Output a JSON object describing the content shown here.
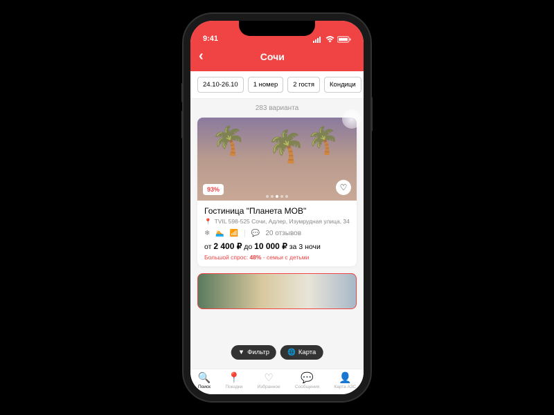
{
  "status": {
    "time": "9:41"
  },
  "header": {
    "title": "Сочи"
  },
  "pills": [
    "24.10-26.10",
    "1 номер",
    "2 гостя",
    "Кондици"
  ],
  "results_count": "283 варианта",
  "hotel": {
    "rating": "93%",
    "name": "Гостиница \"Планета МОВ\"",
    "address": "TVIL 598-525 Сочи, Адлер, Изумрудная улица, 34",
    "reviews": "20 отзывов",
    "price_from_label": "от ",
    "price_from": "2 400 ₽",
    "price_to_label": " до ",
    "price_to": "10 000 ₽",
    "nights": " за 3 ночи",
    "demand_label": "Большой спрос: ",
    "demand_pct": "48%",
    "demand_suffix": " - семьи с детьми"
  },
  "float": {
    "filter": "Фильтр",
    "map": "Карта"
  },
  "tabs": [
    {
      "label": "Поиск"
    },
    {
      "label": "Поездки"
    },
    {
      "label": "Избранное"
    },
    {
      "label": "Сообщения"
    },
    {
      "label": "Карта АЗС"
    }
  ]
}
